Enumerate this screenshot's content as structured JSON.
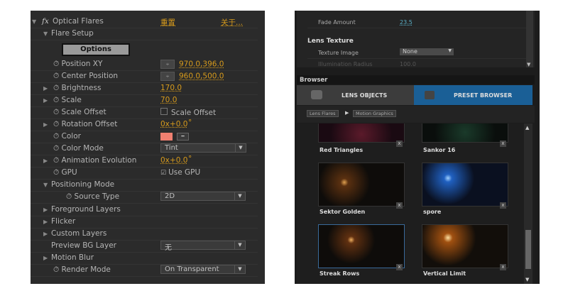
{
  "effects_panel": {
    "effect_name": "Optical Flares",
    "reset_label": "重置",
    "about_label": "关于...",
    "flare_setup": "Flare Setup",
    "options_button": "Options",
    "rows": [
      {
        "label": "Position XY",
        "value": "970.0,396.0"
      },
      {
        "label": "Center Position",
        "value": "960.0,500.0"
      },
      {
        "label": "Brightness",
        "value": "170.0"
      },
      {
        "label": "Scale",
        "value": "70.0"
      },
      {
        "label": "Scale Offset",
        "value": "Scale Offset"
      },
      {
        "label": "Rotation Offset",
        "value": "0x+0.0",
        "unit": "°"
      },
      {
        "label": "Color",
        "color": "#f08070"
      },
      {
        "label": "Color Mode",
        "value": "Tint"
      },
      {
        "label": "Animation Evolution",
        "value": "0x+0.0",
        "unit": "°"
      },
      {
        "label": "GPU",
        "value": "Use GPU",
        "checked": true
      }
    ],
    "positioning_mode": "Positioning Mode",
    "source_type": "Source Type",
    "source_type_value": "2D",
    "foreground_layers": "Foreground Layers",
    "flicker": "Flicker",
    "custom_layers": "Custom Layers",
    "preview_bg": "Preview BG Layer",
    "preview_bg_value": "无",
    "motion_blur": "Motion Blur",
    "render_mode": "Render Mode",
    "render_mode_value": "On Transparent"
  },
  "lens_panel": {
    "fade_amount_label": "Fade Amount",
    "fade_amount_value": "23.5",
    "lens_texture": "Lens Texture",
    "texture_image_label": "Texture Image",
    "texture_image_value": "None",
    "illumination_label": "Illumination Radius",
    "illumination_value": "100.0"
  },
  "browser": {
    "title": "Browser",
    "tab_lens": "LENS OBJECTS",
    "tab_preset": "PRESET BROWSER",
    "breadcrumb": [
      "Lens Flares",
      "Motion Graphics"
    ],
    "presets": [
      "Red Triangles",
      "Sankor 16",
      "Sektor Golden",
      "spore",
      "Streak Rows",
      "Vertical Limit"
    ],
    "accent": "#1a5f96"
  }
}
